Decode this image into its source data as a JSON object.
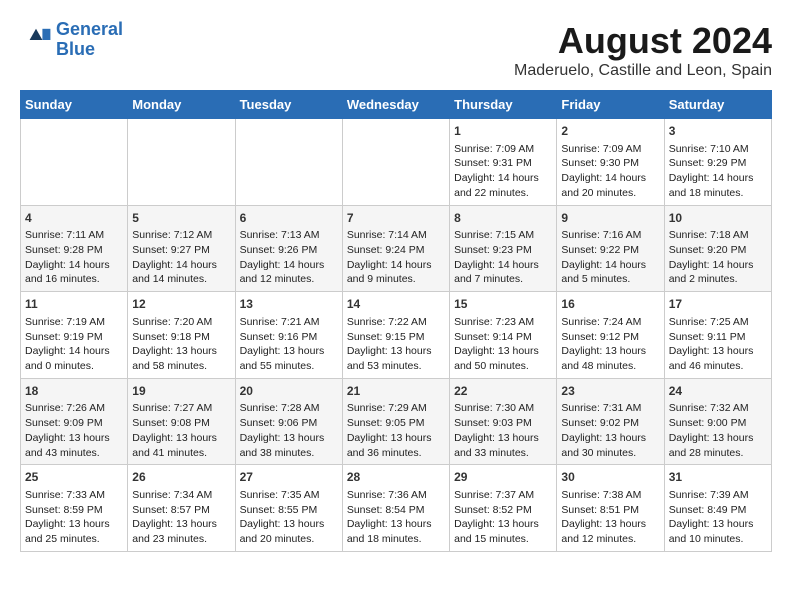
{
  "header": {
    "logo_line1": "General",
    "logo_line2": "Blue",
    "title": "August 2024",
    "subtitle": "Maderuelo, Castille and Leon, Spain"
  },
  "columns": [
    "Sunday",
    "Monday",
    "Tuesday",
    "Wednesday",
    "Thursday",
    "Friday",
    "Saturday"
  ],
  "weeks": [
    [
      {
        "day": "",
        "info": ""
      },
      {
        "day": "",
        "info": ""
      },
      {
        "day": "",
        "info": ""
      },
      {
        "day": "",
        "info": ""
      },
      {
        "day": "1",
        "info": "Sunrise: 7:09 AM\nSunset: 9:31 PM\nDaylight: 14 hours\nand 22 minutes."
      },
      {
        "day": "2",
        "info": "Sunrise: 7:09 AM\nSunset: 9:30 PM\nDaylight: 14 hours\nand 20 minutes."
      },
      {
        "day": "3",
        "info": "Sunrise: 7:10 AM\nSunset: 9:29 PM\nDaylight: 14 hours\nand 18 minutes."
      }
    ],
    [
      {
        "day": "4",
        "info": "Sunrise: 7:11 AM\nSunset: 9:28 PM\nDaylight: 14 hours\nand 16 minutes."
      },
      {
        "day": "5",
        "info": "Sunrise: 7:12 AM\nSunset: 9:27 PM\nDaylight: 14 hours\nand 14 minutes."
      },
      {
        "day": "6",
        "info": "Sunrise: 7:13 AM\nSunset: 9:26 PM\nDaylight: 14 hours\nand 12 minutes."
      },
      {
        "day": "7",
        "info": "Sunrise: 7:14 AM\nSunset: 9:24 PM\nDaylight: 14 hours\nand 9 minutes."
      },
      {
        "day": "8",
        "info": "Sunrise: 7:15 AM\nSunset: 9:23 PM\nDaylight: 14 hours\nand 7 minutes."
      },
      {
        "day": "9",
        "info": "Sunrise: 7:16 AM\nSunset: 9:22 PM\nDaylight: 14 hours\nand 5 minutes."
      },
      {
        "day": "10",
        "info": "Sunrise: 7:18 AM\nSunset: 9:20 PM\nDaylight: 14 hours\nand 2 minutes."
      }
    ],
    [
      {
        "day": "11",
        "info": "Sunrise: 7:19 AM\nSunset: 9:19 PM\nDaylight: 14 hours\nand 0 minutes."
      },
      {
        "day": "12",
        "info": "Sunrise: 7:20 AM\nSunset: 9:18 PM\nDaylight: 13 hours\nand 58 minutes."
      },
      {
        "day": "13",
        "info": "Sunrise: 7:21 AM\nSunset: 9:16 PM\nDaylight: 13 hours\nand 55 minutes."
      },
      {
        "day": "14",
        "info": "Sunrise: 7:22 AM\nSunset: 9:15 PM\nDaylight: 13 hours\nand 53 minutes."
      },
      {
        "day": "15",
        "info": "Sunrise: 7:23 AM\nSunset: 9:14 PM\nDaylight: 13 hours\nand 50 minutes."
      },
      {
        "day": "16",
        "info": "Sunrise: 7:24 AM\nSunset: 9:12 PM\nDaylight: 13 hours\nand 48 minutes."
      },
      {
        "day": "17",
        "info": "Sunrise: 7:25 AM\nSunset: 9:11 PM\nDaylight: 13 hours\nand 46 minutes."
      }
    ],
    [
      {
        "day": "18",
        "info": "Sunrise: 7:26 AM\nSunset: 9:09 PM\nDaylight: 13 hours\nand 43 minutes."
      },
      {
        "day": "19",
        "info": "Sunrise: 7:27 AM\nSunset: 9:08 PM\nDaylight: 13 hours\nand 41 minutes."
      },
      {
        "day": "20",
        "info": "Sunrise: 7:28 AM\nSunset: 9:06 PM\nDaylight: 13 hours\nand 38 minutes."
      },
      {
        "day": "21",
        "info": "Sunrise: 7:29 AM\nSunset: 9:05 PM\nDaylight: 13 hours\nand 36 minutes."
      },
      {
        "day": "22",
        "info": "Sunrise: 7:30 AM\nSunset: 9:03 PM\nDaylight: 13 hours\nand 33 minutes."
      },
      {
        "day": "23",
        "info": "Sunrise: 7:31 AM\nSunset: 9:02 PM\nDaylight: 13 hours\nand 30 minutes."
      },
      {
        "day": "24",
        "info": "Sunrise: 7:32 AM\nSunset: 9:00 PM\nDaylight: 13 hours\nand 28 minutes."
      }
    ],
    [
      {
        "day": "25",
        "info": "Sunrise: 7:33 AM\nSunset: 8:59 PM\nDaylight: 13 hours\nand 25 minutes."
      },
      {
        "day": "26",
        "info": "Sunrise: 7:34 AM\nSunset: 8:57 PM\nDaylight: 13 hours\nand 23 minutes."
      },
      {
        "day": "27",
        "info": "Sunrise: 7:35 AM\nSunset: 8:55 PM\nDaylight: 13 hours\nand 20 minutes."
      },
      {
        "day": "28",
        "info": "Sunrise: 7:36 AM\nSunset: 8:54 PM\nDaylight: 13 hours\nand 18 minutes."
      },
      {
        "day": "29",
        "info": "Sunrise: 7:37 AM\nSunset: 8:52 PM\nDaylight: 13 hours\nand 15 minutes."
      },
      {
        "day": "30",
        "info": "Sunrise: 7:38 AM\nSunset: 8:51 PM\nDaylight: 13 hours\nand 12 minutes."
      },
      {
        "day": "31",
        "info": "Sunrise: 7:39 AM\nSunset: 8:49 PM\nDaylight: 13 hours\nand 10 minutes."
      }
    ]
  ]
}
